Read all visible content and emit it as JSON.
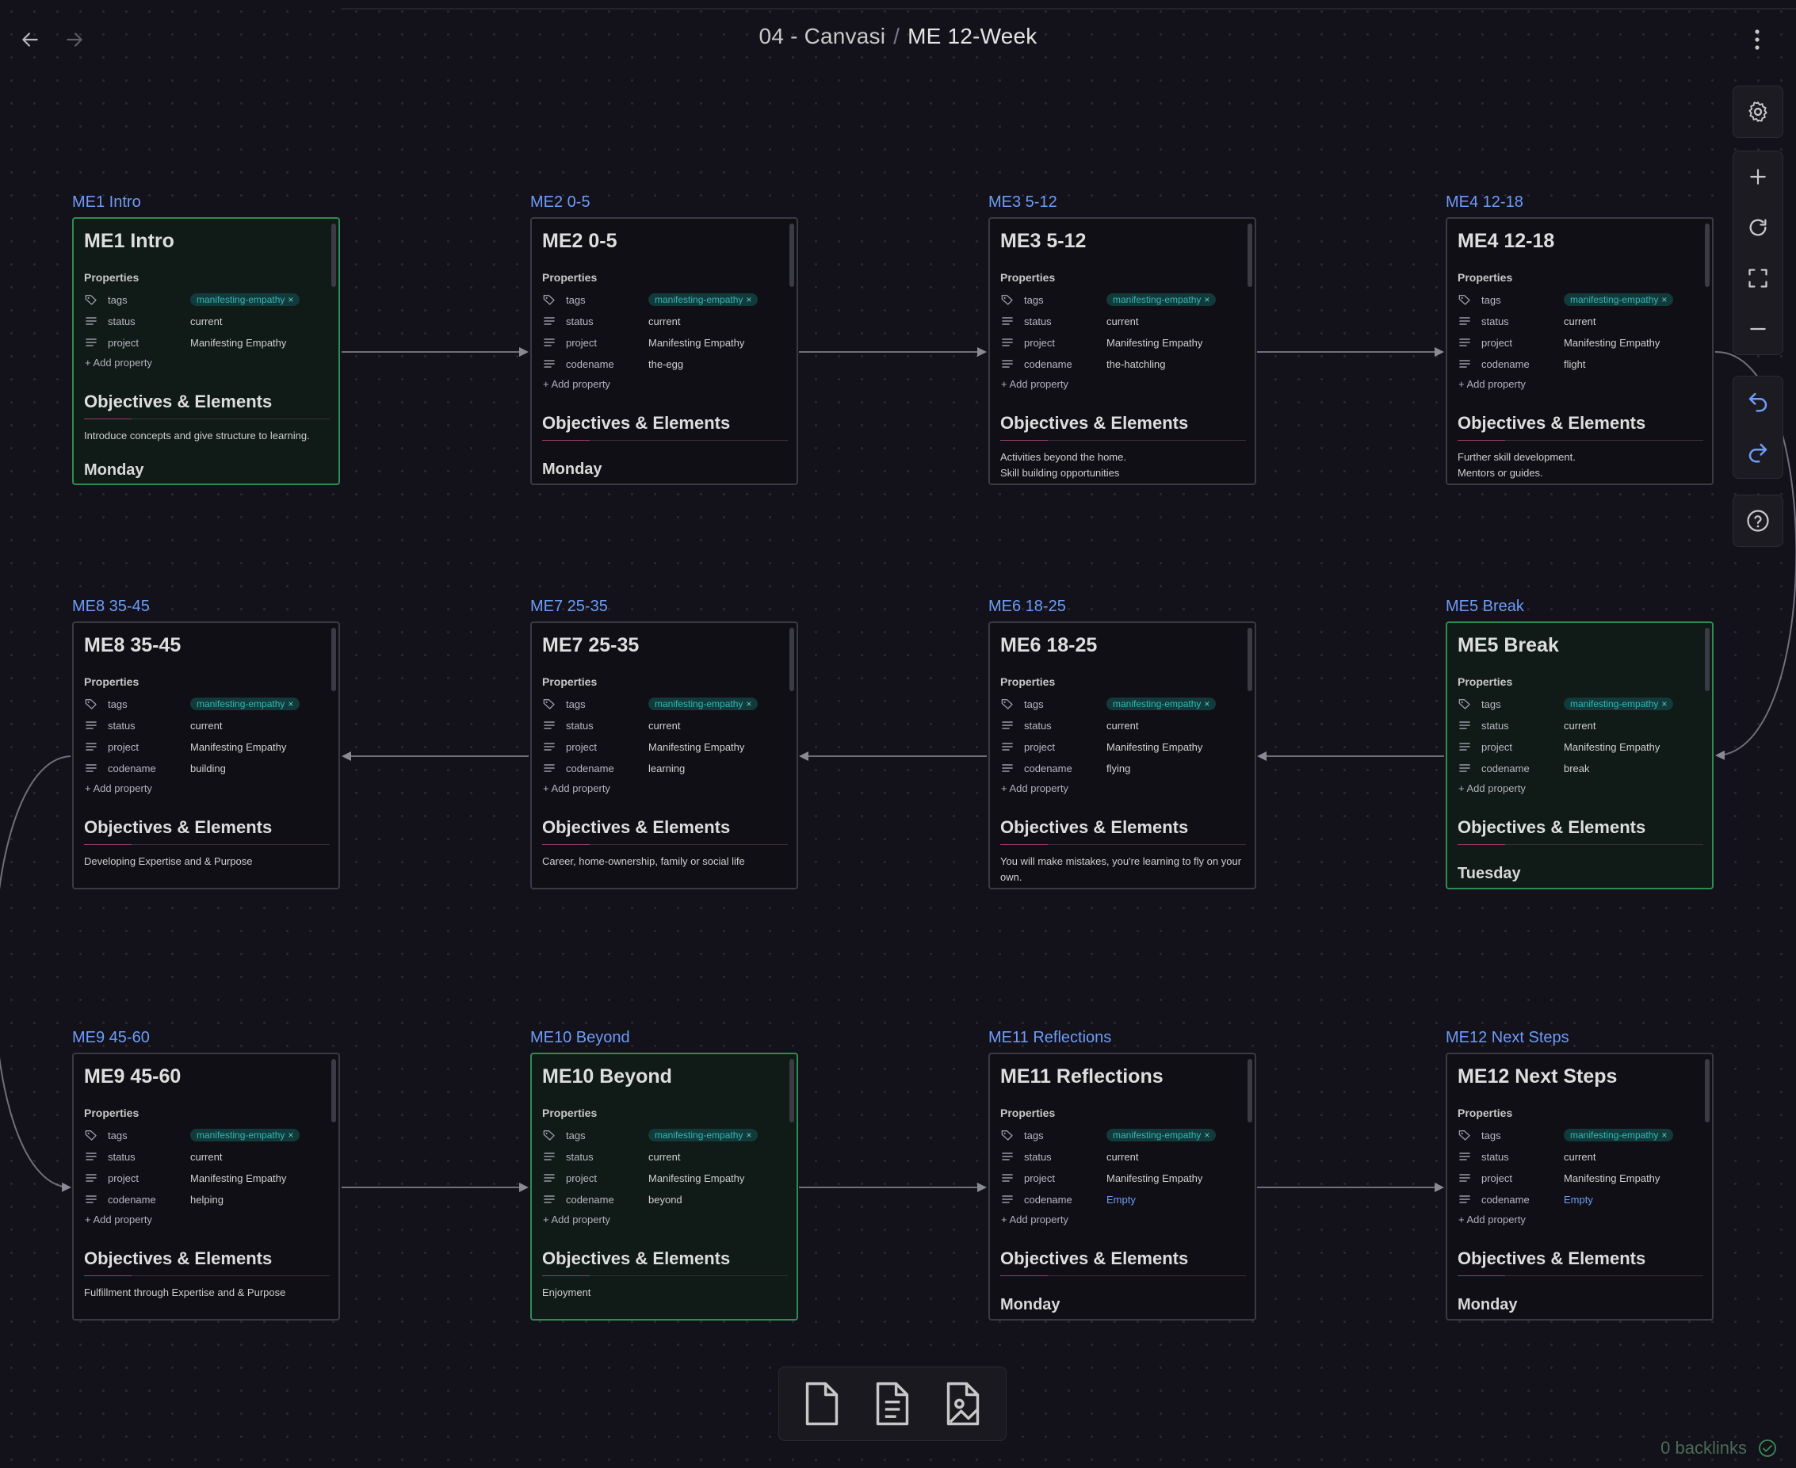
{
  "header": {
    "breadcrumb_parent": "04 - Canvasi",
    "breadcrumb_separator": "/",
    "breadcrumb_current": "ME 12-Week"
  },
  "card_common": {
    "properties_title": "Properties",
    "tags_label": "tags",
    "status_label": "status",
    "project_label": "project",
    "codename_label": "codename",
    "tag_value": "manifesting-empathy",
    "tag_remove": "×",
    "add_property": "Add property",
    "objectives_heading": "Objectives & Elements"
  },
  "cards": [
    {
      "label": "ME1 Intro",
      "title": "ME1 Intro",
      "status": "current",
      "project": "Manifesting Empathy",
      "codename": "",
      "desc": "Introduce concepts and give structure to learning.",
      "next": "Monday",
      "highlight": true
    },
    {
      "label": "ME2 0-5",
      "title": "ME2 0-5",
      "status": "current",
      "project": "Manifesting Empathy",
      "codename": "the-egg",
      "desc": "",
      "next": "Monday",
      "highlight": false
    },
    {
      "label": "ME3 5-12",
      "title": "ME3 5-12",
      "status": "current",
      "project": "Manifesting Empathy",
      "codename": "the-hatchling",
      "desc": "Activities beyond the home.\nSkill building opportunities",
      "next": "",
      "highlight": false
    },
    {
      "label": "ME4 12-18",
      "title": "ME4 12-18",
      "status": "current",
      "project": "Manifesting Empathy",
      "codename": "flight",
      "desc": "Further skill development.\nMentors or guides.",
      "next": "",
      "highlight": false
    },
    {
      "label": "ME8 35-45",
      "title": "ME8 35-45",
      "status": "current",
      "project": "Manifesting Empathy",
      "codename": "building",
      "desc": "Developing Expertise and & Purpose",
      "next": "",
      "highlight": false
    },
    {
      "label": "ME7 25-35",
      "title": "ME7 25-35",
      "status": "current",
      "project": "Manifesting Empathy",
      "codename": "learning",
      "desc": "Career, home-ownership, family or social life",
      "next": "",
      "highlight": false
    },
    {
      "label": "ME6 18-25",
      "title": "ME6 18-25",
      "status": "current",
      "project": "Manifesting Empathy",
      "codename": "flying",
      "desc": "You will make mistakes, you're learning to fly on your own.",
      "next": "",
      "highlight": false
    },
    {
      "label": "ME5 Break",
      "title": "ME5 Break",
      "status": "current",
      "project": "Manifesting Empathy",
      "codename": "break",
      "desc": "",
      "next": "Tuesday",
      "highlight": true
    },
    {
      "label": "ME9 45-60",
      "title": "ME9 45-60",
      "status": "current",
      "project": "Manifesting Empathy",
      "codename": "helping",
      "desc": "Fulfillment through Expertise and & Purpose",
      "next": "",
      "highlight": false
    },
    {
      "label": "ME10 Beyond",
      "title": "ME10 Beyond",
      "status": "current",
      "project": "Manifesting Empathy",
      "codename": "beyond",
      "desc": "Enjoyment",
      "next": "",
      "highlight": true
    },
    {
      "label": "ME11 Reflections",
      "title": "ME11 Reflections",
      "status": "current",
      "project": "Manifesting Empathy",
      "codename": "Empty",
      "desc": "",
      "next": "Monday",
      "highlight": false
    },
    {
      "label": "ME12 Next Steps",
      "title": "ME12 Next Steps",
      "status": "current",
      "project": "Manifesting Empathy",
      "codename": "Empty",
      "desc": "",
      "next": "Monday",
      "highlight": false
    }
  ],
  "controls": [
    "settings-icon",
    "zoom-in-icon",
    "reset-zoom-icon",
    "fit-icon",
    "zoom-out-icon",
    "undo-icon",
    "redo-icon",
    "help-icon"
  ],
  "bottom_toolbar": [
    "new-card-icon",
    "note-card-icon",
    "media-card-icon"
  ],
  "status_bar": {
    "backlinks": "0 backlinks"
  },
  "colors": {
    "accent": "#6e9cf7",
    "tag_text": "#35b6b6",
    "highlight_border": "#2f8c53",
    "background": "#13111a"
  }
}
